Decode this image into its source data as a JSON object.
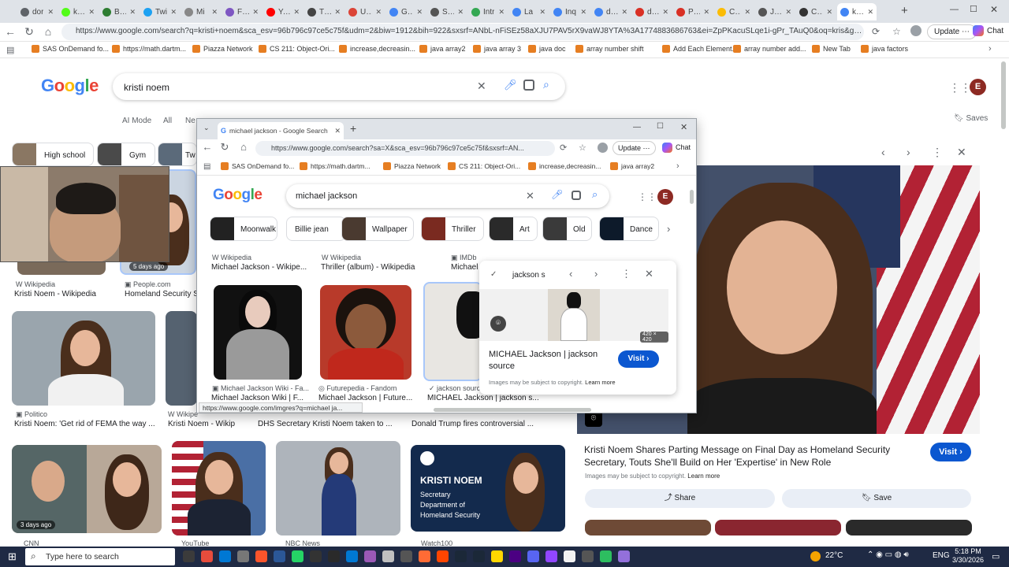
{
  "outer_tabs": [
    {
      "label": "dor"
    },
    {
      "label": "kick"
    },
    {
      "label": "Bro"
    },
    {
      "label": "Twi"
    },
    {
      "label": "Mi"
    },
    {
      "label": "Foll"
    },
    {
      "label": "You"
    },
    {
      "label": "The"
    },
    {
      "label": "Use"
    },
    {
      "label": "Goo"
    },
    {
      "label": "Spe"
    },
    {
      "label": "Intr"
    },
    {
      "label": "La"
    },
    {
      "label": "Inq"
    },
    {
      "label": "defi"
    },
    {
      "label": "des"
    },
    {
      "label": "Proj"
    },
    {
      "label": "Cut"
    },
    {
      "label": "Jag"
    },
    {
      "label": "Cha"
    },
    {
      "label": "kris"
    }
  ],
  "outer_url": "https://www.google.com/search?q=kristi+noem&sca_esv=96b796c97ce5c75f&udm=2&biw=1912&bih=922&sxsrf=ANbL-nFiSEz58aXJU7PAV5rX9vaWJ8YTA%3A1774883686763&ei=ZpPKacuSLqe1i-gPr_TAuQ0&oq=kris&gs_lp=Egtnd3...",
  "outer_toolbar": {
    "update_label": "Update",
    "chat_label": "Chat"
  },
  "bookmarks": [
    "SAS OnDemand fo...",
    "https://math.dartm...",
    "Piazza Network",
    "CS 211: Object-Ori...",
    "increase,decreasin...",
    "java array2",
    "java array 3",
    "java doc",
    "array number shift",
    "Add Each Element...",
    "array number add...",
    "New Tab",
    "java factors"
  ],
  "outer_search": {
    "query": "kristi noem",
    "avatar": "E"
  },
  "outer_filters": {
    "ai_mode": "AI Mode",
    "all": "All",
    "ne": "Ne",
    "saves": "Saves"
  },
  "outer_chips": [
    {
      "label": "High school"
    },
    {
      "label": "Gym"
    },
    {
      "label": "Tw"
    }
  ],
  "outer_results": [
    {
      "source": "Wikipedia",
      "title": "Kristi Noem - Wikipedia"
    },
    {
      "source": "People.com",
      "title": "Homeland Security S"
    },
    {
      "badge": "5 days ago"
    },
    {
      "source": "Politico",
      "title": "Kristi Noem: 'Get rid of FEMA the way ..."
    },
    {
      "source": "Wikipe",
      "title": "Kristi Noem - Wikip"
    },
    {
      "title": "DHS Secretary Kristi Noem taken to ..."
    },
    {
      "title": "Donald Trump fires controversial ..."
    },
    {
      "badge": "3 days ago"
    },
    {
      "source": "CNN"
    },
    {
      "source": "YouTube"
    },
    {
      "source": "NBC News"
    },
    {
      "source": "Watch100"
    }
  ],
  "dhs_card": {
    "line1": "KRISTI NOEM",
    "line2": "Secretary",
    "line3": "Department of",
    "line4": "Homeland Security"
  },
  "outer_panel": {
    "title": "Kristi Noem Shares Parting Message on Final Day as Homeland Security Secretary, Touts She'll Build on Her 'Expertise' in New Role",
    "visit": "Visit",
    "copyright": "Images may be subject to copyright.",
    "learn_more": "Learn more",
    "share": "Share",
    "save": "Save"
  },
  "inner": {
    "tab_title": "michael jackson - Google Search",
    "url": "https://www.google.com/search?sa=X&sca_esv=96b796c97ce5c75f&sxsrf=AN...",
    "update_label": "Update",
    "chat_label": "Chat",
    "bookmarks": [
      "SAS OnDemand fo...",
      "https://math.dartm...",
      "Piazza Network",
      "CS 211: Object-Ori...",
      "increase,decreasin...",
      "java array2"
    ],
    "query": "michael jackson",
    "avatar": "E",
    "chips": [
      {
        "label": "Moonwalk"
      },
      {
        "label": "Billie jean"
      },
      {
        "label": "Wallpaper"
      },
      {
        "label": "Thriller"
      },
      {
        "label": "Art"
      },
      {
        "label": "Old"
      },
      {
        "label": "Dance"
      }
    ],
    "top_results": [
      {
        "source": "Wikipedia",
        "title": "Michael Jackson - Wikipe..."
      },
      {
        "source": "Wikipedia",
        "title": "Thriller (album) - Wikipedia"
      },
      {
        "source": "IMDb",
        "title": "Michael J"
      }
    ],
    "bottom_results": [
      {
        "source": "Michael Jackson Wiki - Fa...",
        "title": "Michael Jackson Wiki | F..."
      },
      {
        "source": "Futurepedia - Fandom",
        "title": "Michael Jackson | Future..."
      },
      {
        "source": "jackson source",
        "title": "MICHAEL Jackson | jackson s..."
      }
    ],
    "status_url": "https://www.google.com/imgres?q=michael ja...",
    "popup": {
      "header": "jackson s",
      "size": "420 × 420",
      "title": "MICHAEL Jackson | jackson source",
      "visit": "Visit",
      "copyright": "Images may be subject to copyright.",
      "learn_more": "Learn more"
    }
  },
  "taskbar": {
    "search_placeholder": "Type here to search",
    "weather": "22°C",
    "lang": "ENG",
    "time": "5:18 PM",
    "date": "3/30/2026"
  },
  "colors": {
    "accent_blue": "#0b57d0",
    "link_blue": "#1a0dab",
    "taskbar": "#1f2a44"
  }
}
